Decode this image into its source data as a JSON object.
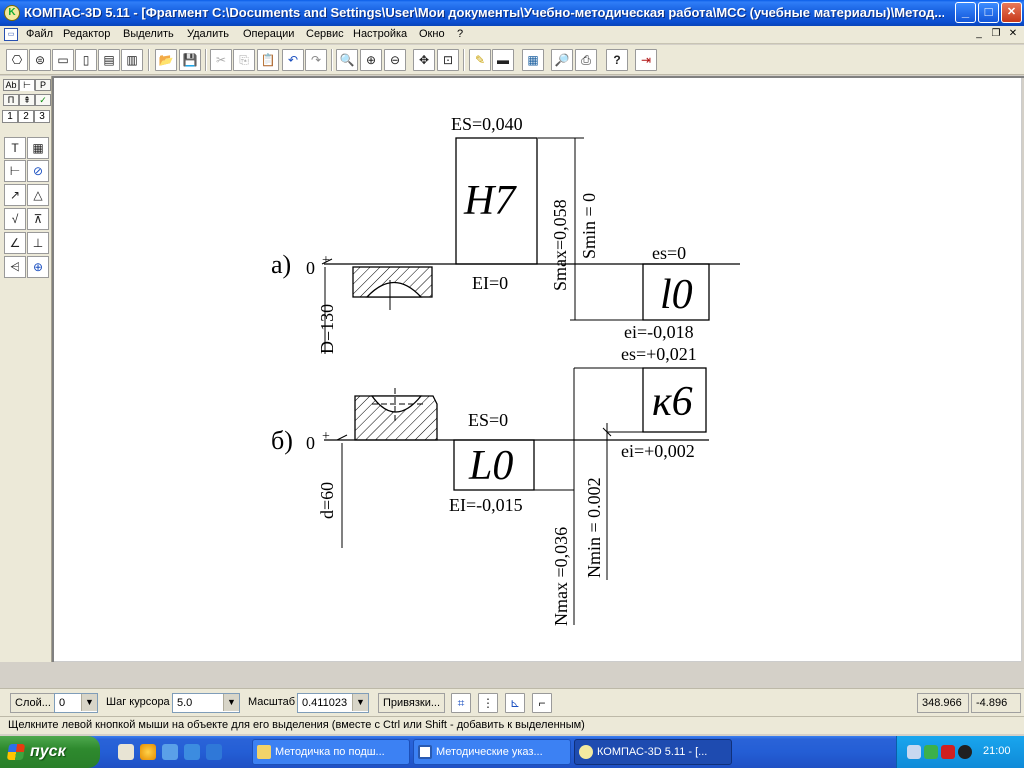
{
  "window": {
    "title": "КОМПАС-3D 5.11 - [Фрагмент C:\\Documents and Settings\\User\\Мои документы\\Учебно-методическая работа\\МСС (учебные материалы)\\Метод...",
    "minimize": "_",
    "maximize": "□",
    "close": "✕"
  },
  "menu": {
    "items": [
      "Файл",
      "Редактор",
      "Выделить",
      "Удалить",
      "Операции",
      "Сервис",
      "Настройка",
      "Окно",
      "?"
    ],
    "mdi_min": "_",
    "mdi_restore": "❐",
    "mdi_close": "✕"
  },
  "toolbar": {
    "icons": [
      "new-sheet-icon",
      "spec-icon",
      "new-fragment-icon",
      "new-document-icon",
      "new-text-icon",
      "new-table-icon",
      "open-icon",
      "save-icon",
      "cut-icon",
      "copy-icon",
      "paste-icon",
      "undo-icon",
      "redo-icon",
      "zoom-icon",
      "zoom-in-icon",
      "zoom-out-icon",
      "pan-icon",
      "zoom-all-icon",
      "refresh-icon",
      "layers-icon",
      "calculator-icon",
      "preview-icon",
      "print-icon",
      "help-icon",
      "exit-icon"
    ],
    "glyphs": [
      "⎔",
      "⊜",
      "▭",
      "▯",
      "▤",
      "▥",
      "📂",
      "💾",
      "✂",
      "⎘",
      "📋",
      "↶",
      "↷",
      "🔍",
      "⊕",
      "⊖",
      "✥",
      "⊡",
      "✎",
      "▬",
      "▦",
      "🔎",
      "⎙",
      "?",
      "⇥"
    ]
  },
  "palette": {
    "tabs_row1": [
      "Ab",
      "⊢",
      "P"
    ],
    "tabs_row2": [
      "П",
      "⇞",
      "✓"
    ],
    "numbers": [
      "1",
      "2",
      "3"
    ],
    "buttons": [
      {
        "name": "text-tool-icon",
        "glyph": "T"
      },
      {
        "name": "table-tool-icon",
        "glyph": "▦"
      },
      {
        "name": "dimension-tool-icon",
        "glyph": "⊢"
      },
      {
        "name": "diameter-tool-icon",
        "glyph": "⊘"
      },
      {
        "name": "radius-tool-icon",
        "glyph": "↗"
      },
      {
        "name": "angle-tool-icon",
        "glyph": "△"
      },
      {
        "name": "roughness-tool-icon",
        "glyph": "√"
      },
      {
        "name": "base-tool-icon",
        "glyph": "⊼"
      },
      {
        "name": "leader-tool-icon",
        "glyph": "∠"
      },
      {
        "name": "position-tool-icon",
        "glyph": "⊥"
      },
      {
        "name": "tolerance-tool-icon",
        "glyph": "⩤"
      },
      {
        "name": "center-tool-icon",
        "glyph": "⊕"
      }
    ]
  },
  "drawing": {
    "a_label": "а)",
    "b_label": "б)",
    "zero_a": "0",
    "zero_b": "0",
    "plus_a": "+",
    "plus_b": "+",
    "ES_a": "ES=0,040",
    "EI_a": "EI=0",
    "H7": "H7",
    "Smax": "Smax=0,058",
    "Smin": "Smin = 0",
    "es_a": "es=0",
    "l0": "l0",
    "ei_a": "ei=-0,018",
    "D": "D=130",
    "es_b": "es=+0,021",
    "k6": "к6",
    "ES_b": "ES=0",
    "L0": "L0",
    "ei_b": "ei=+0,002",
    "EI_b": "EI=-0,015",
    "Nmax": "Nmax =0,036",
    "Nmin": "Nmin = 0.002",
    "d": "d=60"
  },
  "status": {
    "layer_label": "Слой...",
    "layer_value": "0",
    "step_label": "Шаг курсора",
    "step_value": "5.0",
    "scale_label": "Масштаб",
    "scale_value": "0.411023",
    "snap_label": "Привязки...",
    "coord_x": "348.966",
    "coord_y": "-4.896",
    "hint": "Щелкните левой кнопкой мыши на объекте для его выделения (вместе с Ctrl или Shift - добавить к выделенным)"
  },
  "taskbar": {
    "start": "пуск",
    "tasks": [
      "Методичка по подш...",
      "Методические указ...",
      "КОМПАС-3D 5.11 - [..."
    ],
    "clock": "21:00"
  }
}
